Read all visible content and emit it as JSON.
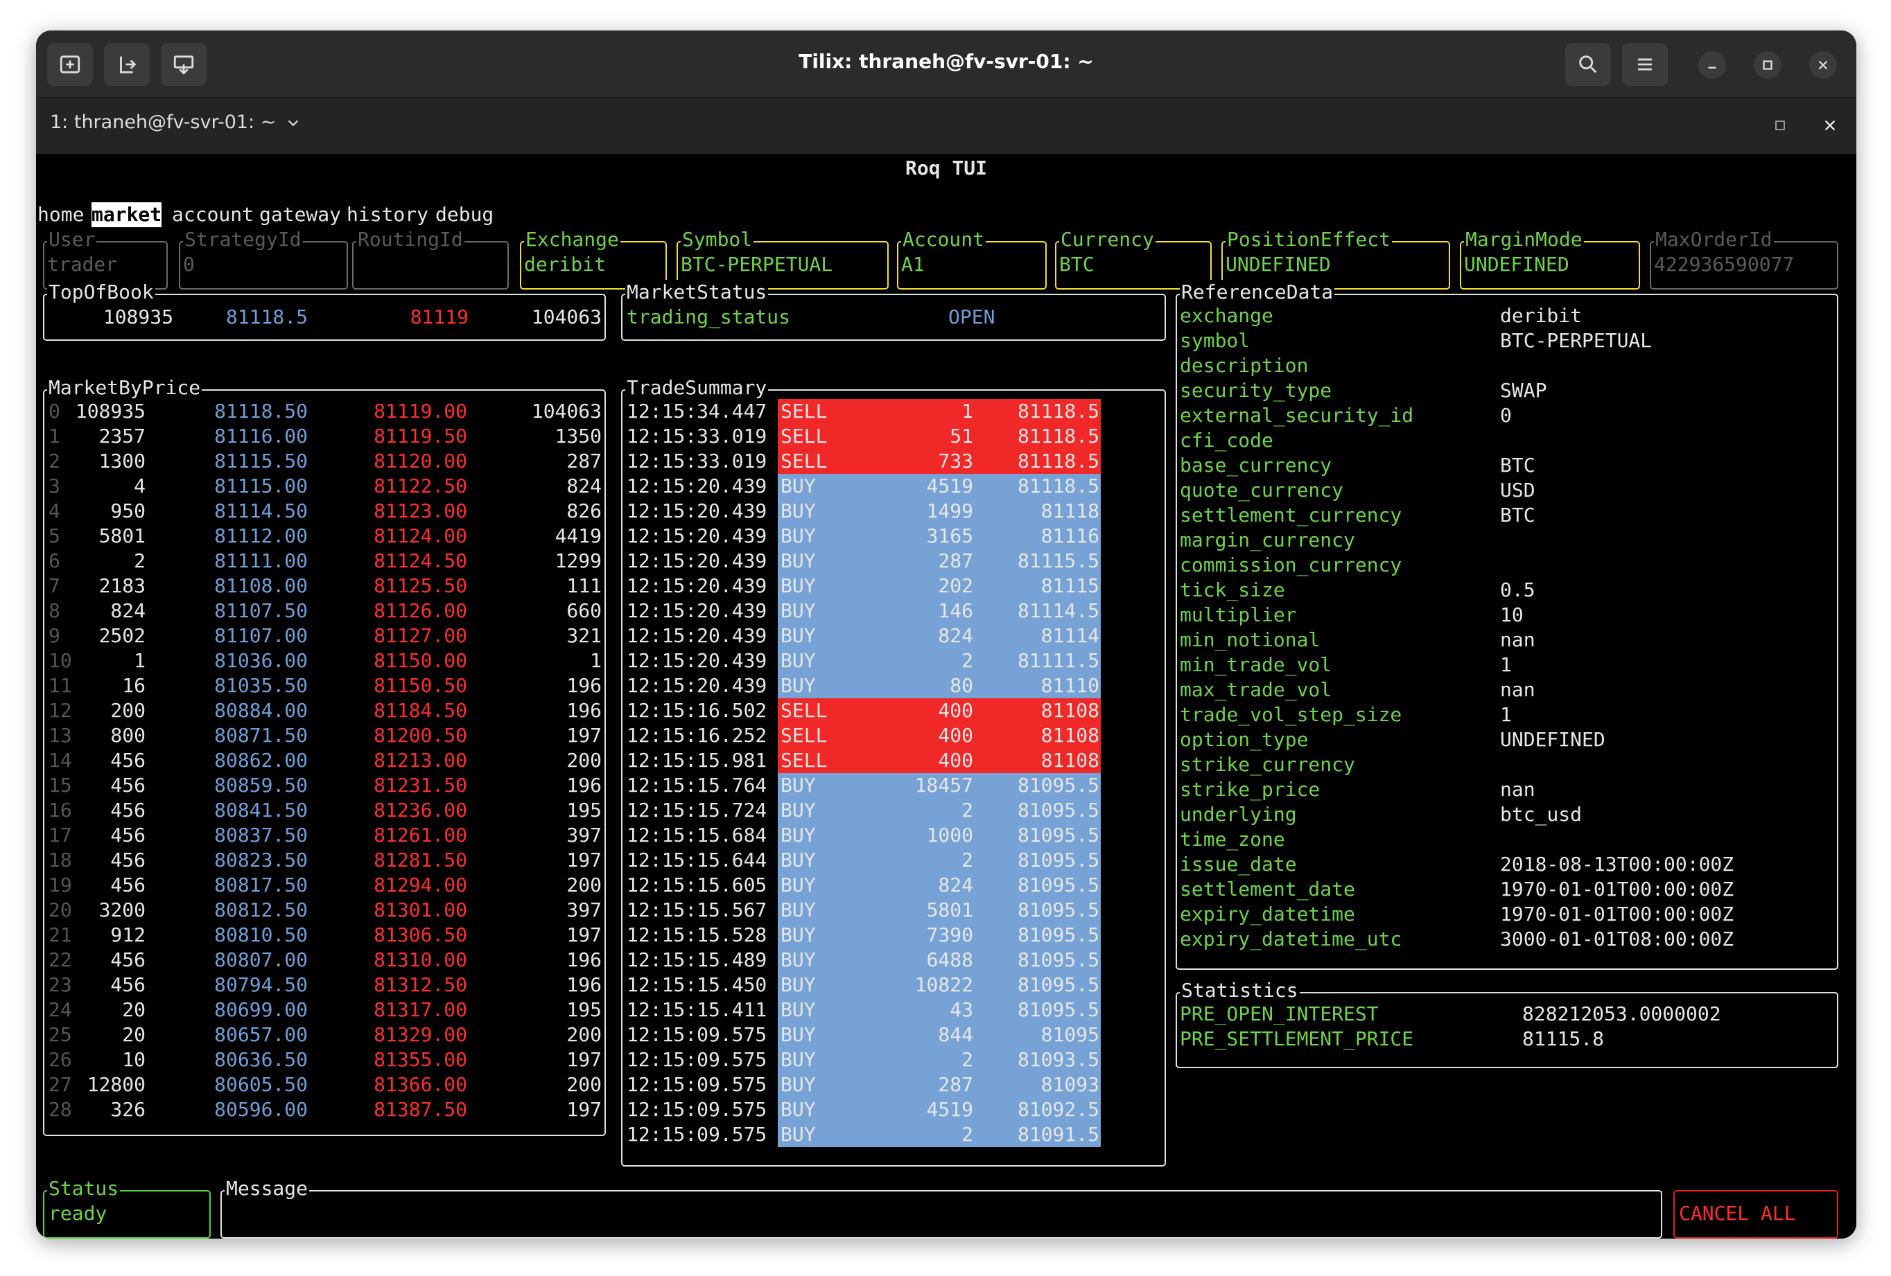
{
  "window": {
    "title": "Tilix: thraneh@fv-svr-01: ~"
  },
  "tab": {
    "title": "1: thraneh@fv-svr-01: ~"
  },
  "app": {
    "title": "Roq TUI"
  },
  "nav": [
    {
      "label": "home",
      "active": false
    },
    {
      "label": "market",
      "active": true
    },
    {
      "label": "account",
      "active": false
    },
    {
      "label": "gateway",
      "active": false
    },
    {
      "label": "history",
      "active": false
    },
    {
      "label": "debug",
      "active": false
    }
  ],
  "fields": [
    {
      "label": "User",
      "value": "trader",
      "enabled": false
    },
    {
      "label": "StrategyId",
      "value": "0",
      "enabled": false
    },
    {
      "label": "RoutingId",
      "value": "",
      "enabled": false
    },
    {
      "label": "Exchange",
      "value": "deribit",
      "enabled": true
    },
    {
      "label": "Symbol",
      "value": "BTC-PERPETUAL",
      "enabled": true
    },
    {
      "label": "Account",
      "value": "A1",
      "enabled": true
    },
    {
      "label": "Currency",
      "value": "BTC",
      "enabled": true
    },
    {
      "label": "PositionEffect",
      "value": "UNDEFINED",
      "enabled": true
    },
    {
      "label": "MarginMode",
      "value": "UNDEFINED",
      "enabled": true
    },
    {
      "label": "MaxOrderId",
      "value": "422936590077",
      "enabled": false
    }
  ],
  "top_of_book": {
    "label": "TopOfBook",
    "bid_qty": "108935",
    "bid": "81118.5",
    "ask": "81119",
    "ask_qty": "104063"
  },
  "market_status": {
    "label": "MarketStatus",
    "key": "trading_status",
    "value": "OPEN"
  },
  "market_by_price": {
    "label": "MarketByPrice",
    "rows": [
      [
        "0",
        "108935",
        "81118.50",
        "81119.00",
        "104063"
      ],
      [
        "1",
        "2357",
        "81116.00",
        "81119.50",
        "1350"
      ],
      [
        "2",
        "1300",
        "81115.50",
        "81120.00",
        "287"
      ],
      [
        "3",
        "4",
        "81115.00",
        "81122.50",
        "824"
      ],
      [
        "4",
        "950",
        "81114.50",
        "81123.00",
        "826"
      ],
      [
        "5",
        "5801",
        "81112.00",
        "81124.00",
        "4419"
      ],
      [
        "6",
        "2",
        "81111.00",
        "81124.50",
        "1299"
      ],
      [
        "7",
        "2183",
        "81108.00",
        "81125.50",
        "111"
      ],
      [
        "8",
        "824",
        "81107.50",
        "81126.00",
        "660"
      ],
      [
        "9",
        "2502",
        "81107.00",
        "81127.00",
        "321"
      ],
      [
        "10",
        "1",
        "81036.00",
        "81150.00",
        "1"
      ],
      [
        "11",
        "16",
        "81035.50",
        "81150.50",
        "196"
      ],
      [
        "12",
        "200",
        "80884.00",
        "81184.50",
        "196"
      ],
      [
        "13",
        "800",
        "80871.50",
        "81200.50",
        "197"
      ],
      [
        "14",
        "456",
        "80862.00",
        "81213.00",
        "200"
      ],
      [
        "15",
        "456",
        "80859.50",
        "81231.50",
        "196"
      ],
      [
        "16",
        "456",
        "80841.50",
        "81236.00",
        "195"
      ],
      [
        "17",
        "456",
        "80837.50",
        "81261.00",
        "397"
      ],
      [
        "18",
        "456",
        "80823.50",
        "81281.50",
        "197"
      ],
      [
        "19",
        "456",
        "80817.50",
        "81294.00",
        "200"
      ],
      [
        "20",
        "3200",
        "80812.50",
        "81301.00",
        "397"
      ],
      [
        "21",
        "912",
        "80810.50",
        "81306.50",
        "197"
      ],
      [
        "22",
        "456",
        "80807.00",
        "81310.00",
        "196"
      ],
      [
        "23",
        "456",
        "80794.50",
        "81312.50",
        "196"
      ],
      [
        "24",
        "20",
        "80699.00",
        "81317.00",
        "195"
      ],
      [
        "25",
        "20",
        "80657.00",
        "81329.00",
        "200"
      ],
      [
        "26",
        "10",
        "80636.50",
        "81355.00",
        "197"
      ],
      [
        "27",
        "12800",
        "80605.50",
        "81366.00",
        "200"
      ],
      [
        "28",
        "326",
        "80596.00",
        "81387.50",
        "197"
      ]
    ]
  },
  "trade_summary": {
    "label": "TradeSummary",
    "rows": [
      [
        "12:15:34.447",
        "SELL",
        "1",
        "81118.5"
      ],
      [
        "12:15:33.019",
        "SELL",
        "51",
        "81118.5"
      ],
      [
        "12:15:33.019",
        "SELL",
        "733",
        "81118.5"
      ],
      [
        "12:15:20.439",
        "BUY",
        "4519",
        "81118.5"
      ],
      [
        "12:15:20.439",
        "BUY",
        "1499",
        "81118"
      ],
      [
        "12:15:20.439",
        "BUY",
        "3165",
        "81116"
      ],
      [
        "12:15:20.439",
        "BUY",
        "287",
        "81115.5"
      ],
      [
        "12:15:20.439",
        "BUY",
        "202",
        "81115"
      ],
      [
        "12:15:20.439",
        "BUY",
        "146",
        "81114.5"
      ],
      [
        "12:15:20.439",
        "BUY",
        "824",
        "81114"
      ],
      [
        "12:15:20.439",
        "BUY",
        "2",
        "81111.5"
      ],
      [
        "12:15:20.439",
        "BUY",
        "80",
        "81110"
      ],
      [
        "12:15:16.502",
        "SELL",
        "400",
        "81108"
      ],
      [
        "12:15:16.252",
        "SELL",
        "400",
        "81108"
      ],
      [
        "12:15:15.981",
        "SELL",
        "400",
        "81108"
      ],
      [
        "12:15:15.764",
        "BUY",
        "18457",
        "81095.5"
      ],
      [
        "12:15:15.724",
        "BUY",
        "2",
        "81095.5"
      ],
      [
        "12:15:15.684",
        "BUY",
        "1000",
        "81095.5"
      ],
      [
        "12:15:15.644",
        "BUY",
        "2",
        "81095.5"
      ],
      [
        "12:15:15.605",
        "BUY",
        "824",
        "81095.5"
      ],
      [
        "12:15:15.567",
        "BUY",
        "5801",
        "81095.5"
      ],
      [
        "12:15:15.528",
        "BUY",
        "7390",
        "81095.5"
      ],
      [
        "12:15:15.489",
        "BUY",
        "6488",
        "81095.5"
      ],
      [
        "12:15:15.450",
        "BUY",
        "10822",
        "81095.5"
      ],
      [
        "12:15:15.411",
        "BUY",
        "43",
        "81095.5"
      ],
      [
        "12:15:09.575",
        "BUY",
        "844",
        "81095"
      ],
      [
        "12:15:09.575",
        "BUY",
        "2",
        "81093.5"
      ],
      [
        "12:15:09.575",
        "BUY",
        "287",
        "81093"
      ],
      [
        "12:15:09.575",
        "BUY",
        "4519",
        "81092.5"
      ],
      [
        "12:15:09.575",
        "BUY",
        "2",
        "81091.5"
      ]
    ]
  },
  "reference_data": {
    "label": "ReferenceData",
    "rows": [
      [
        "exchange",
        "deribit"
      ],
      [
        "symbol",
        "BTC-PERPETUAL"
      ],
      [
        "description",
        ""
      ],
      [
        "security_type",
        "SWAP"
      ],
      [
        "external_security_id",
        "0"
      ],
      [
        "cfi_code",
        ""
      ],
      [
        "base_currency",
        "BTC"
      ],
      [
        "quote_currency",
        "USD"
      ],
      [
        "settlement_currency",
        "BTC"
      ],
      [
        "margin_currency",
        ""
      ],
      [
        "commission_currency",
        ""
      ],
      [
        "tick_size",
        "0.5"
      ],
      [
        "multiplier",
        "10"
      ],
      [
        "min_notional",
        "nan"
      ],
      [
        "min_trade_vol",
        "1"
      ],
      [
        "max_trade_vol",
        "nan"
      ],
      [
        "trade_vol_step_size",
        "1"
      ],
      [
        "option_type",
        "UNDEFINED"
      ],
      [
        "strike_currency",
        ""
      ],
      [
        "strike_price",
        "nan"
      ],
      [
        "underlying",
        "btc_usd"
      ],
      [
        "time_zone",
        ""
      ],
      [
        "issue_date",
        "2018-08-13T00:00:00Z"
      ],
      [
        "settlement_date",
        "1970-01-01T00:00:00Z"
      ],
      [
        "expiry_datetime",
        "1970-01-01T00:00:00Z"
      ],
      [
        "expiry_datetime_utc",
        "3000-01-01T08:00:00Z"
      ]
    ]
  },
  "statistics": {
    "label": "Statistics",
    "rows": [
      [
        "PRE_OPEN_INTEREST",
        "828212053.0000002"
      ],
      [
        "PRE_SETTLEMENT_PRICE",
        "81115.8"
      ]
    ]
  },
  "status": {
    "label": "Status",
    "value": "ready"
  },
  "message": {
    "label": "Message",
    "value": ""
  },
  "cancel_all": {
    "label": "CANCEL ALL"
  },
  "colors": {
    "bid": "#6f9fd8",
    "ask": "#ff2d2d",
    "key": "#6fd24a",
    "sell_bg": "#f02828",
    "buy_bg": "#76a2d6",
    "field_active": "#f0e02c"
  },
  "icons": [
    "new-session-icon",
    "add-terminal-right-icon",
    "add-terminal-down-icon",
    "search-icon",
    "hamburger-menu-icon",
    "minimize-icon",
    "maximize-icon",
    "close-icon"
  ]
}
